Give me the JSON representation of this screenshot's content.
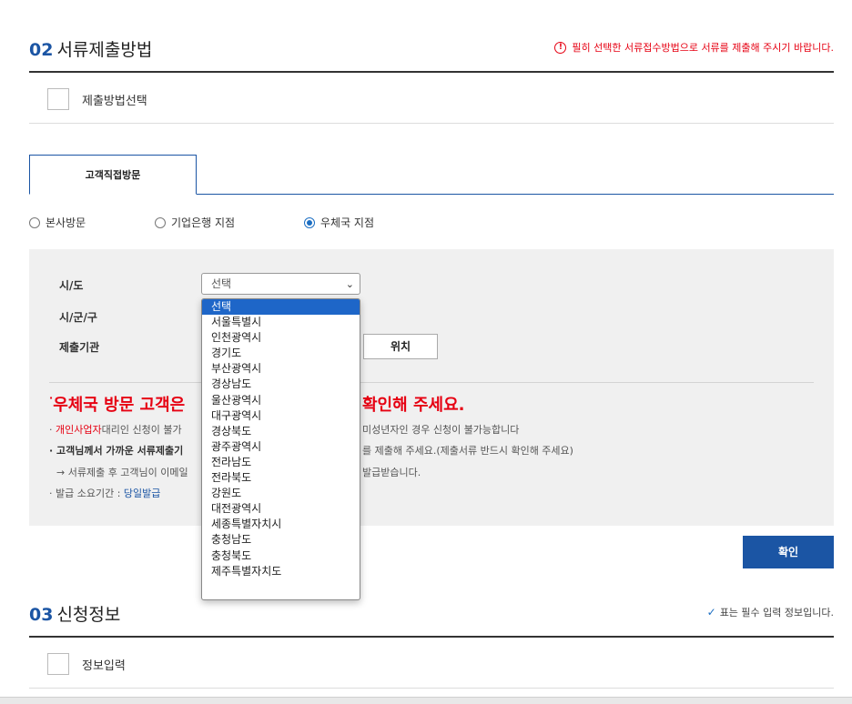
{
  "section2": {
    "num": "02",
    "title": "서류제출방법",
    "note_icon": "warning-circle-icon",
    "note": "필히 선택한 서류접수방법으로 서류를 제출해 주시기 바랍니다."
  },
  "submit_method": {
    "label": "제출방법선택"
  },
  "tab": {
    "label": "고객직접방문"
  },
  "radios": [
    {
      "label": "본사방문",
      "checked": false
    },
    {
      "label": "기업은행 지점",
      "checked": false
    },
    {
      "label": "우체국 지점",
      "checked": true
    }
  ],
  "form": {
    "sido_label": "시/도",
    "sigungu_label": "시/군/구",
    "office_label": "제출기관",
    "sido_value": "선택",
    "location_button": "위치"
  },
  "notice": {
    "title_left": "우체국 방문 고객은",
    "title_right": "확인해 주세요.",
    "line1_bullet": "·",
    "line1_red": "개인사업자",
    "line1_text": "대리인 신청이 불가",
    "line1_tail": "미성년자인 경우 신청이 불가능합니다",
    "line2_bold": "· 고객님께서 가까운 서류제출기",
    "line2_tail": "를 제출해 주세요.(제출서류 반드시 확인해 주세요)",
    "line3_text": "→ 서류제출 후 고객님이 이메일",
    "line3_tail": "발급받습니다.",
    "line4_text": "· 발급 소요기간 : ",
    "line4_blue": "당일발급"
  },
  "dropdown_options": [
    "선택",
    "서울특별시",
    "인천광역시",
    "경기도",
    "부산광역시",
    "경상남도",
    "울산광역시",
    "대구광역시",
    "경상북도",
    "광주광역시",
    "전라남도",
    "전라북도",
    "강원도",
    "대전광역시",
    "세종특별자치시",
    "충청남도",
    "충청북도",
    "제주특별자치도"
  ],
  "confirm_button": "확인",
  "section3": {
    "num": "03",
    "title": "신청정보",
    "req_icon": "checkmark-icon",
    "req_note": "표는 필수 입력 정보입니다."
  },
  "info_input": {
    "label": "정보입력"
  },
  "colors": {
    "primary": "#1b55a4",
    "alert": "#e60012",
    "panel": "#f0f0f0"
  }
}
